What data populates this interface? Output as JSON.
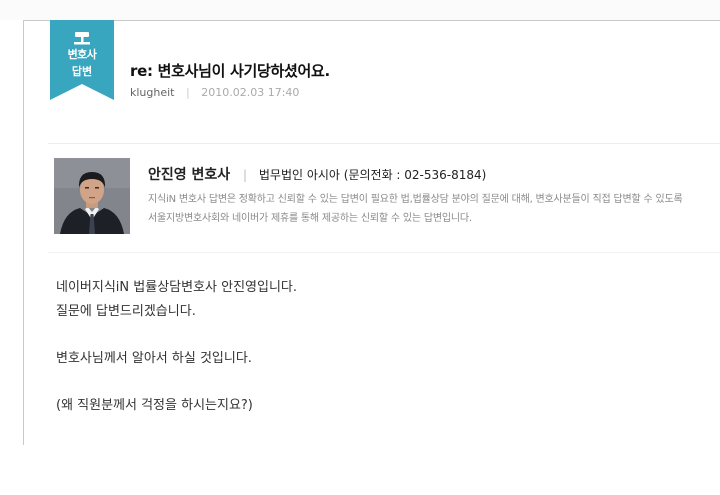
{
  "badge": {
    "line1": "변호사",
    "line2": "답변"
  },
  "question": {
    "title": "re: 변호사님이 사기당하셨어요.",
    "author": "klugheit",
    "date": "2010.02.03 17:40"
  },
  "lawyer": {
    "name": "안진영 변호사",
    "firm": "법무법인 아시아 (문의전화 : 02-536-8184)",
    "description": "지식iN 변호사 답변은 정확하고 신뢰할 수 있는 답변이 필요한 법,법률상담 분야의 질문에 대해, 변호사분들이 직접 답변할 수 있도록 서울지방변호사회와 네이버가 제휴를 통해 제공하는 신뢰할 수 있는 답변입니다."
  },
  "answer": {
    "line1": "네이버지식iN 법률상담변호사 안진영입니다.",
    "line2": "질문에 답변드리겠습니다.",
    "line3": "변호사님께서 알아서 하실 것입니다.",
    "line4": "(왜 직원분께서 걱정을 하시는지요?)"
  },
  "colors": {
    "badge": "#39a6c0",
    "description": "#8a8a8a"
  }
}
